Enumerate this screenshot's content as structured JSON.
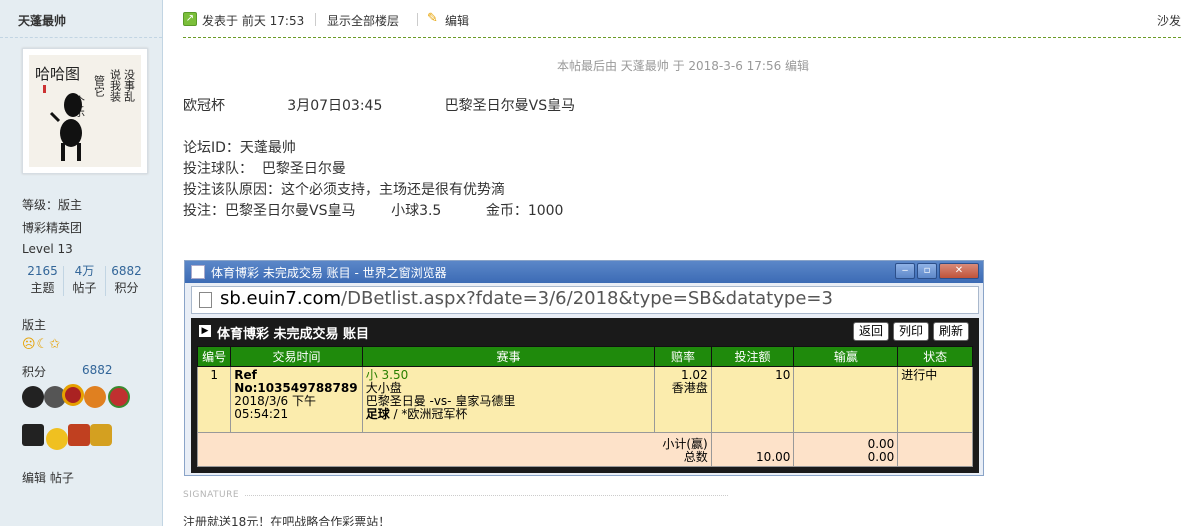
{
  "user": {
    "name": "天蓬最帅",
    "level_label": "等级：版主",
    "group": "博彩精英团",
    "level": "Level 13",
    "stats": [
      {
        "num": "2165",
        "label": "主题"
      },
      {
        "num": "4万",
        "label": "帖子"
      },
      {
        "num": "6882",
        "label": "积分"
      }
    ],
    "role": "版主",
    "emoticons": "☹☾✩",
    "points_label": "积分",
    "points": "6882",
    "actions": "编辑 帖子",
    "avatar_text": "哈哈图 管它俺个乐 说我装文艺精 没事乱涂鸦"
  },
  "post": {
    "posted_at": "发表于 前天 17:53",
    "show_all": "显示全部楼层",
    "edit": "编辑",
    "floor": "沙发",
    "last_edit": "本帖最后由 天蓬最帅 于 2018-3-6 17:56 编辑",
    "line1": "欧冠杯              3月07日03:45              巴黎圣日尔曼VS皇马",
    "line2": "论坛ID：天蓬最帅",
    "line3": "投注球队：  巴黎圣日尔曼",
    "line4": "投注该队原因：这个必须支持，主场还是很有优势滴",
    "line5": "投注：巴黎圣日尔曼VS皇马        小球3.5          金币：1000",
    "signature_label": "SIGNATURE",
    "signature_text": "注册就送18元！在吧战略合作彩票站！"
  },
  "screenshot": {
    "window_title": "体育博彩 未完成交易 账目 - 世界之窗浏览器",
    "url_host": "sb.euin7.com",
    "url_path": "/DBetlist.aspx?fdate=3/6/2018&type=SB&datatype=3",
    "panel_title": "体育博彩 未完成交易 账目",
    "btn_back": "返回",
    "btn_print": "列印",
    "btn_refresh": "刷新",
    "headers": [
      "编号",
      "交易时间",
      "赛事",
      "赔率",
      "投注额",
      "输赢",
      "状态"
    ],
    "row": {
      "no": "1",
      "ref": "Ref No:103549788789",
      "time": "2018/3/6 下午 05:54:21",
      "bet": "小 3.50",
      "market": "大小盘",
      "match": "巴黎圣日曼 -vs- 皇家马德里",
      "sport": "足球",
      "league": " / *欧洲冠军杯",
      "odds": "1.02",
      "odds_type": "香港盘",
      "stake": "10",
      "result": "",
      "status": "进行中"
    },
    "sum": {
      "label1": "小计(赢)",
      "label2": "总数",
      "stake_total": "10.00",
      "win1": "0.00",
      "win2": "0.00"
    }
  }
}
